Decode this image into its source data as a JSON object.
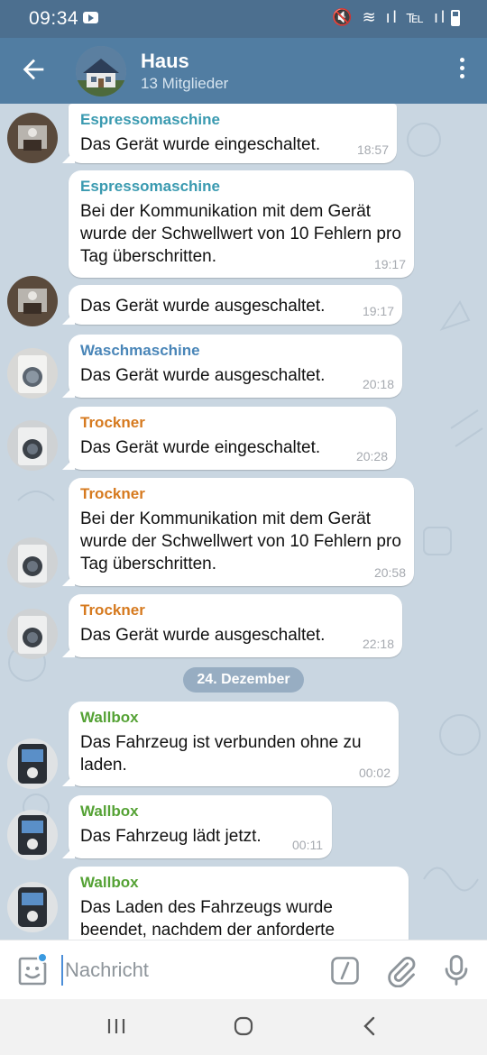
{
  "status_bar": {
    "time": "09:34"
  },
  "header": {
    "title": "Haus",
    "subtitle": "13 Mitglieder"
  },
  "messages": [
    {
      "sender": "Espressomaschine",
      "text": "Das Gerät wurde eingeschaltet.",
      "time": "18:57"
    },
    {
      "sender": "Espressomaschine",
      "text": "Bei der Kommunikation mit dem Gerät wurde der Schwellwert von 10 Fehlern pro Tag überschritten.",
      "time": "19:17"
    },
    {
      "sender": "",
      "text": "Das Gerät wurde ausgeschaltet.",
      "time": "19:17"
    },
    {
      "sender": "Waschmaschine",
      "text": "Das Gerät wurde ausgeschaltet.",
      "time": "20:18"
    },
    {
      "sender": "Trockner",
      "text": "Das Gerät wurde eingeschaltet.",
      "time": "20:28"
    },
    {
      "sender": "Trockner",
      "text": "Bei der Kommunikation mit dem Gerät wurde der Schwellwert von 10 Fehlern pro Tag überschritten.",
      "time": "20:58"
    },
    {
      "sender": "Trockner",
      "text": "Das Gerät wurde ausgeschaltet.",
      "time": "22:18"
    },
    {
      "sender": "Wallbox",
      "text": "Das Fahrzeug ist verbunden ohne zu laden.",
      "time": "00:02"
    },
    {
      "sender": "Wallbox",
      "text": "Das Fahrzeug lädt jetzt.",
      "time": "00:11"
    },
    {
      "sender": "Wallbox",
      "text": "Das Laden des Fahrzeugs wurde beendet, nachdem der anforderte",
      "time": ""
    }
  ],
  "date_separator": "24. Dezember",
  "input": {
    "placeholder": "Nachricht"
  },
  "colors": {
    "header": "#517da2",
    "status_bar": "#4c6f8f",
    "chat_background": "#c9d6e1",
    "sender_espresso": "#3a9ab0",
    "sender_waschmaschine": "#4a86b8",
    "sender_trockner": "#d67a1f",
    "sender_wallbox": "#55a235"
  }
}
